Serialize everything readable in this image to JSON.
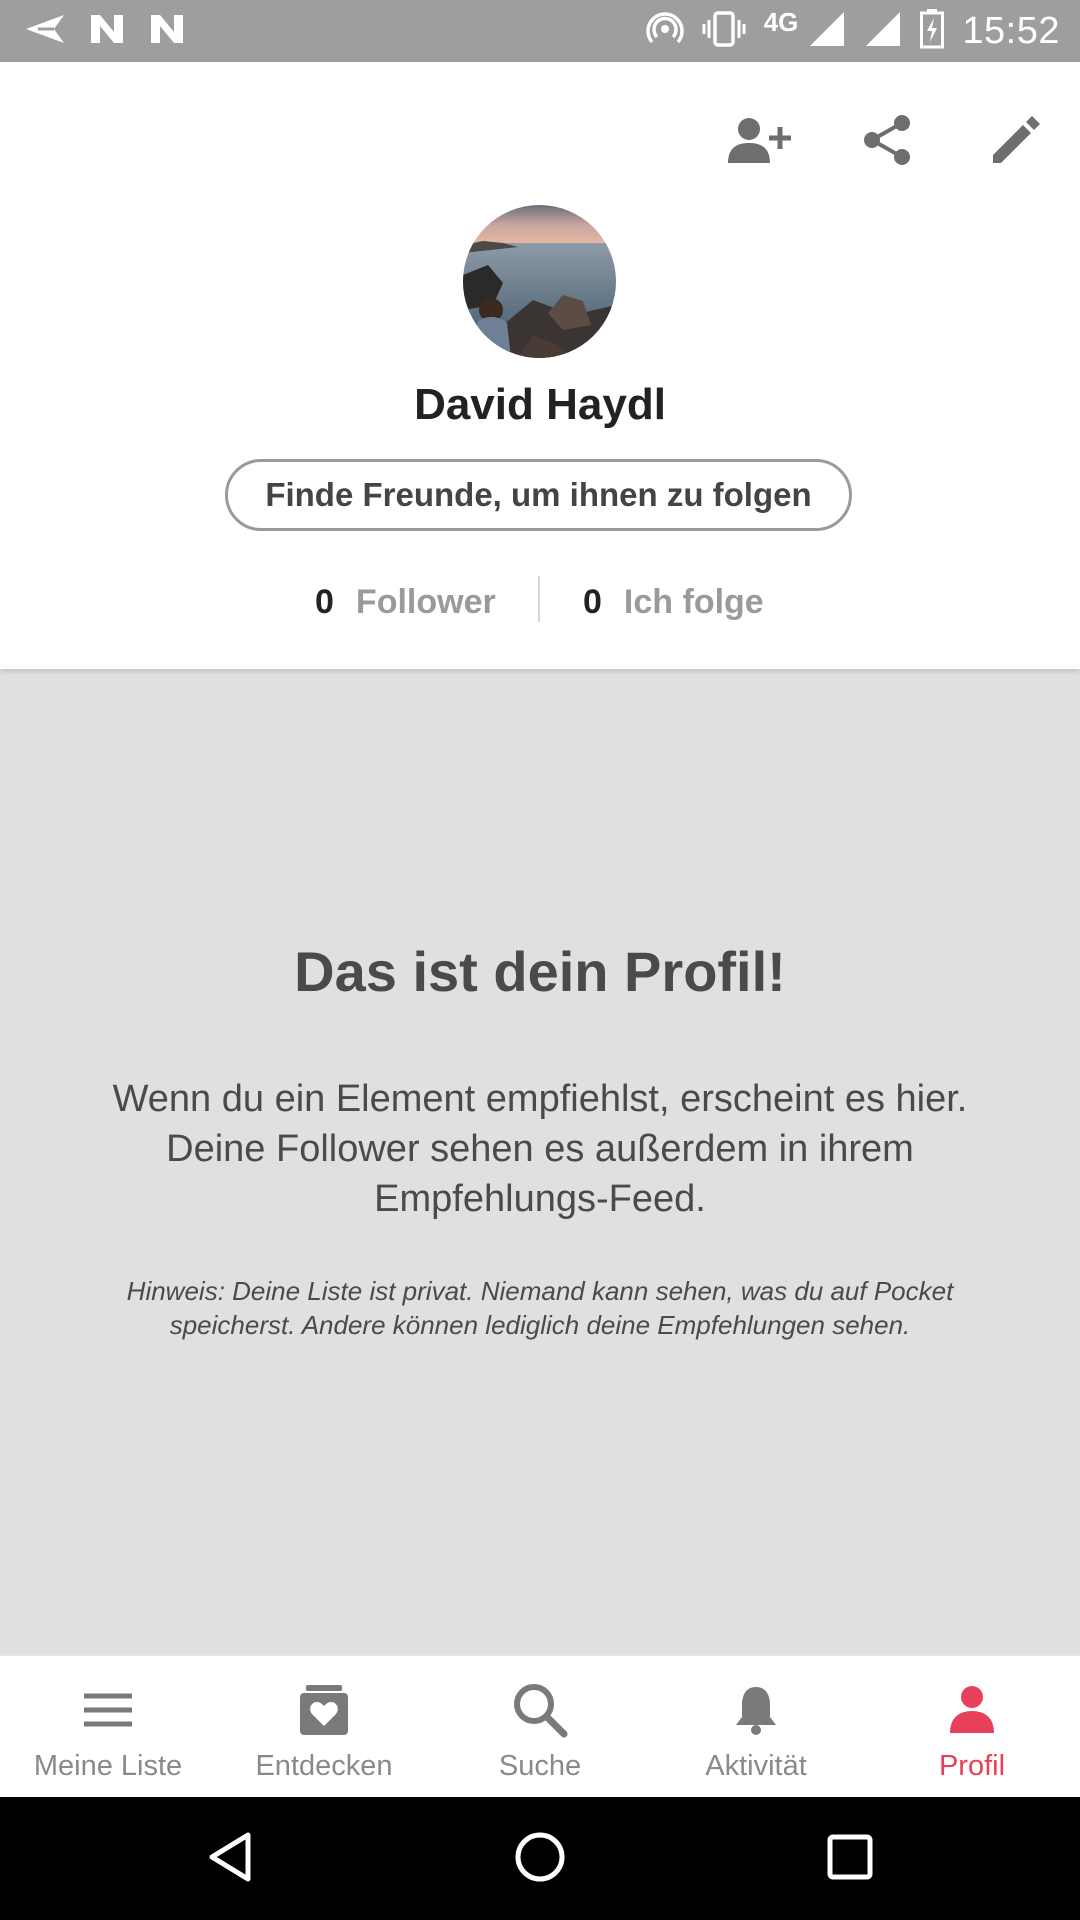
{
  "status_bar": {
    "time": "15:52",
    "network": "4G",
    "icons": [
      "paper-plane-icon",
      "n-notification-icon",
      "n-notification-icon",
      "hotspot-icon",
      "vibrate-icon",
      "signal-icon",
      "signal-icon",
      "battery-charging-icon"
    ]
  },
  "header": {
    "actions": [
      "add-user-icon",
      "share-icon",
      "edit-pencil-icon"
    ],
    "profile_name": "David Haydl",
    "find_friends_label": "Finde Freunde, um ihnen zu folgen",
    "followers": {
      "count": "0",
      "label": "Follower"
    },
    "following": {
      "count": "0",
      "label": "Ich folge"
    }
  },
  "empty_state": {
    "title": "Das ist dein Profil!",
    "body": "Wenn du ein Element empfiehlst, erscheint es hier. Deine Follower sehen es außerdem in ihrem Empfehlungs-Feed.",
    "note": "Hinweis: Deine Liste ist privat. Niemand kann sehen, was du auf Pocket speicherst. Andere können lediglich deine Empfehlungen sehen."
  },
  "bottom_nav": {
    "items": [
      {
        "label": "Meine Liste",
        "icon": "list-icon"
      },
      {
        "label": "Entdecken",
        "icon": "discover-heart-icon"
      },
      {
        "label": "Suche",
        "icon": "search-icon"
      },
      {
        "label": "Aktivität",
        "icon": "bell-icon"
      },
      {
        "label": "Profil",
        "icon": "person-icon"
      }
    ],
    "active_index": 4,
    "active_color": "#e8405a",
    "inactive_color": "#8a8a8a"
  },
  "system_nav": [
    "back-icon",
    "home-icon",
    "recents-icon"
  ]
}
